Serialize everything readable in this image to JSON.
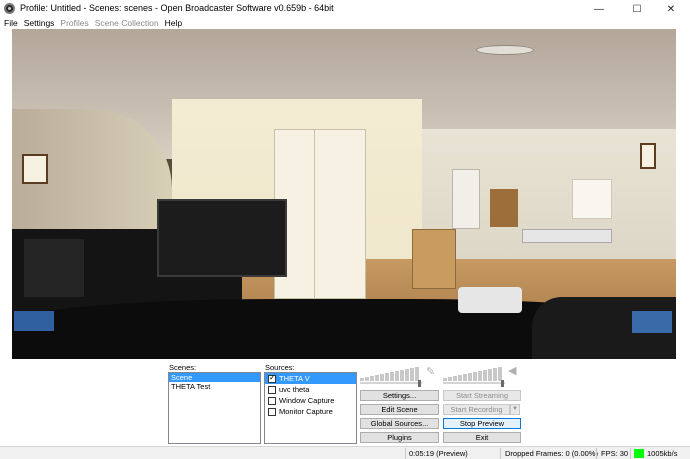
{
  "window": {
    "title": "Profile: Untitled - Scenes: scenes - Open Broadcaster Software v0.659b - 64bit",
    "minimize_icon": "minimize-icon",
    "maximize_icon": "maximize-icon",
    "close_icon": "close-icon"
  },
  "menu": {
    "file": "File",
    "settings": "Settings",
    "profiles": "Profiles",
    "scene_collection": "Scene Collection",
    "help": "Help"
  },
  "scenes": {
    "label": "Scenes:",
    "items": [
      "Scene",
      "THETA Test"
    ],
    "selected_index": 0
  },
  "sources": {
    "label": "Sources:",
    "items": [
      {
        "name": "THETA V",
        "checked": true,
        "selected": true
      },
      {
        "name": "uvc theta",
        "checked": false,
        "selected": false
      },
      {
        "name": "Window Capture",
        "checked": false,
        "selected": false
      },
      {
        "name": "Monitor Capture",
        "checked": false,
        "selected": false
      }
    ]
  },
  "audio": {
    "mic_icon": "microphone-icon",
    "speaker_icon": "speaker-icon"
  },
  "buttons": {
    "settings": "Settings...",
    "edit_scene": "Edit Scene",
    "global_sources": "Global Sources...",
    "plugins": "Plugins",
    "start_streaming": "Start Streaming",
    "start_recording": "Start Recording",
    "stop_preview": "Stop Preview",
    "exit": "Exit"
  },
  "status": {
    "time": "0:05:19 (Preview)",
    "dropped_frames": "Dropped Frames: 0 (0.00%)",
    "fps": "FPS: 30",
    "bitrate": "1005kb/s",
    "indicator_color": "#00ff00"
  }
}
